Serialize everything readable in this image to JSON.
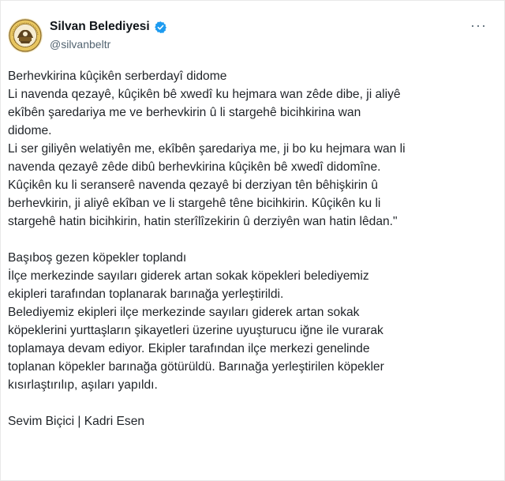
{
  "account": {
    "display_name": "Silvan Belediyesi",
    "handle": "@silvanbeltr",
    "verified": true,
    "avatar_icon": "silvan-municipality-seal"
  },
  "menu": {
    "more_label": "···"
  },
  "tweet": {
    "kurdish_lines": [
      "Berhevkirina kûçikên serberdayî didome",
      "Li navenda qezayê, kûçikên bê xwedî ku hejmara wan zêde dibe, ji aliyê",
      "ekîbên şaredariya me ve berhevkirin û li stargehê bicihkirina wan",
      "didome.",
      "Li ser giliyên welatiyên me, ekîbên şaredariya me, ji bo ku hejmara wan li",
      "navenda qezayê zêde dibû berhevkirina kûçikên bê xwedî didomîne.",
      "Kûçikên ku li seranserê navenda qezayê bi derziyan tên bêhişkirin û",
      "berhevkirin, ji aliyê ekîban ve li stargehê têne bicihkirin. Kûçikên ku li",
      "stargehê hatin bicihkirin, hatin sterîlîzekirin û derziyên wan hatin lêdan.\""
    ],
    "turkish_lines": [
      "Başıboş gezen köpekler toplandı",
      "İlçe merkezinde sayıları giderek artan sokak köpekleri belediyemiz",
      "ekipleri tarafından toplanarak barınağa yerleştirildi.",
      "Belediyemiz ekipleri ilçe merkezinde sayıları giderek artan sokak",
      "köpeklerini yurttaşların şikayetleri üzerine uyuşturucu iğne ile vurarak",
      "toplamaya devam ediyor. Ekipler tarafından ilçe merkezi genelinde",
      "toplanan köpekler barınağa götürüldü. Barınağa yerleştirilen köpekler",
      "kısırlaştırılıp, aşıları yapıldı."
    ],
    "signature": "Sevim Biçici | Kadri Esen"
  },
  "colors": {
    "text": "#1f2328",
    "secondary": "#536471",
    "verified_blue": "#1d9bf0",
    "seal_gold": "#d9b24a",
    "seal_dark": "#6b4e1e"
  }
}
